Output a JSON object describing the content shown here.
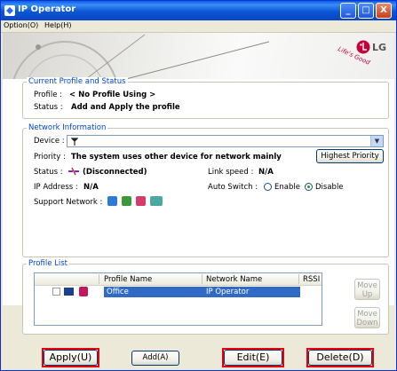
{
  "window": {
    "title": "IP Operator"
  },
  "titlebar_buttons": {
    "minimize": "_",
    "maximize": "□",
    "close": "X"
  },
  "menu": {
    "option": "Option(O)",
    "help": "Help(H)"
  },
  "brand": {
    "logo_text": "LG",
    "tagline": "Life's Good"
  },
  "current_profile": {
    "legend": "Current Profile and Status",
    "profile_label": "Profile :",
    "profile_value": "< No Profile Using >",
    "status_label": "Status :",
    "status_value": "Add and Apply the profile"
  },
  "network_info": {
    "legend": "Network Information",
    "device_label": "Device :",
    "priority_label": "Priority :",
    "priority_value": "The system uses other device for network mainly",
    "highest_priority_button": "Highest Priority",
    "status_label": "Status :",
    "status_value": "(Disconnected)",
    "link_speed_label": "Link speed :",
    "link_speed_value": "N/A",
    "ip_label": "IP Address :",
    "ip_value": "N/A",
    "auto_switch_label": "Auto Switch :",
    "enable_label": "Enable",
    "disable_label": "Disable",
    "auto_switch_selected": "Disable",
    "support_network_label": "Support Network :"
  },
  "profile_list": {
    "legend": "Profile List",
    "columns": [
      "Profile Name",
      "Network Name",
      "RSSI"
    ],
    "rows": [
      {
        "profile_name": "Office",
        "network_name": "IP Operator",
        "rssi": ""
      }
    ],
    "move_up": "Move Up",
    "move_down": "Move Down"
  },
  "actions": {
    "apply": "Apply(U)",
    "add": "Add(A)",
    "edit": "Edit(E)",
    "delete": "Delete(D)"
  },
  "colors": {
    "title_bar": "#0a55d6",
    "legend_text": "#0046d5",
    "selection": "#316ac5",
    "highlight_box": "#e8000a",
    "lg_red": "#c4003c"
  }
}
